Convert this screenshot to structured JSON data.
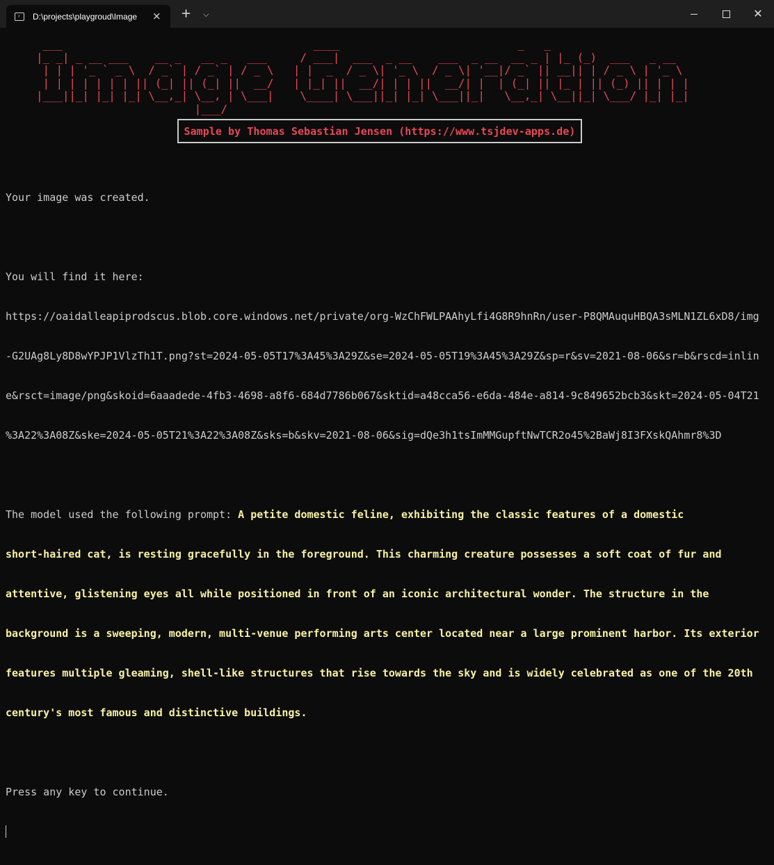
{
  "window": {
    "tab_title": "D:\\projects\\playgroud\\Image",
    "tab_close_icon": "×",
    "new_tab_icon": "+",
    "dropdown_icon": "⌵",
    "close_icon": "✕"
  },
  "banner": {
    "ascii_lines": [
      " ___                                      ____                           _   _             ",
      "|_ _| _ __ ___    __ _   __ _   ___     / ___|  ___  _ __    ___  _ __  __ _ | |_ (_)  ___   _ __  ",
      " | | | '_ ` _ \\  / _` | / _` | / _ \\   | |  _  / _ \\| '_ \\  / _ \\| '__|/ _` || __|| | / _ \\ | '_ \\ ",
      " | | | | | | | || (_| || (_| ||  __/   | |_| ||  __/| | | ||  __/| |  | (_| || |_ | || (_) || | | |",
      "|___||_| |_| |_| \\__,_| \\__, | \\___|    \\____| \\___||_| |_| \\___||_|   \\__,_| \\__||_| \\___/ |_| |_|",
      "                        |___/                                                                      "
    ],
    "color": "#e74856"
  },
  "sample_credit": "Sample by Thomas Sebastian Jensen (https://www.tsjdev-apps.de)",
  "output": {
    "created_message": "Your image was created.",
    "find_label": "You will find it here:",
    "url_lines": [
      "https://oaidalleapiprodscus.blob.core.windows.net/private/org-WzChFWLPAAhyLfi4G8R9hnRn/user-P8QMAuquHBQA3sMLN1ZL6xD8/img",
      "-G2UAg8Ly8D8wYPJP1VlzTh1T.png?st=2024-05-05T17%3A45%3A29Z&se=2024-05-05T19%3A45%3A29Z&sp=r&sv=2021-08-06&sr=b&rscd=inlin",
      "e&rsct=image/png&skoid=6aaadede-4fb3-4698-a8f6-684d7786b067&sktid=a48cca56-e6da-484e-a814-9c849652bcb3&skt=2024-05-04T21",
      "%3A22%3A08Z&ske=2024-05-05T21%3A22%3A08Z&sks=b&skv=2021-08-06&sig=dQe3h1tsImMMGupftNwTCR2o45%2BaWj8I3FXskQAhmr8%3D"
    ],
    "prompt_label": "The model used the following prompt: ",
    "prompt_lines": [
      "A petite domestic feline, exhibiting the classic features of a domestic",
      "short-haired cat, is resting gracefully in the foreground. This charming creature possesses a soft coat of fur and",
      "attentive, glistening eyes all while positioned in front of an iconic architectural wonder. The structure in the",
      "background is a sweeping, modern, multi-venue performing arts center located near a large prominent harbor. Its exterior",
      "features multiple gleaming, shell-like structures that rise towards the sky and is widely celebrated as one of the 20th",
      "century's most famous and distinctive buildings."
    ],
    "continue_message": "Press any key to continue."
  },
  "colors": {
    "background": "#0c0c0c",
    "titlebar": "#1f1f1f",
    "text": "#cccccc",
    "red": "#e74856",
    "yellow": "#f9f1a5"
  }
}
